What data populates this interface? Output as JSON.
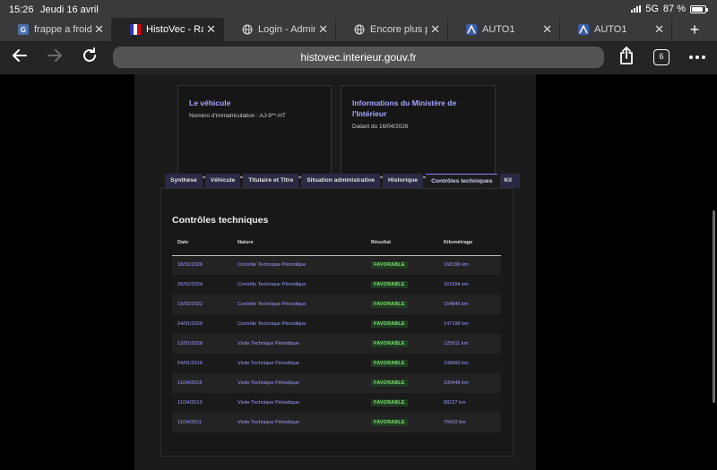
{
  "status": {
    "time": "15:26",
    "date": "Jeudi 16 avril",
    "network": "5G",
    "battery": "87 %"
  },
  "browser": {
    "tabs": [
      {
        "title": "frappe a froid c",
        "icon": "G",
        "color": "#4b6fa8"
      },
      {
        "title": "HistoVec - Rap",
        "icon": "HV",
        "color": "#24248a"
      },
      {
        "title": "Login - Admin",
        "icon": "globe",
        "color": "#3a3a3c"
      },
      {
        "title": "Encore plus pu",
        "icon": "globe",
        "color": "#3a3a3c"
      },
      {
        "title": "AUTO1",
        "icon": "A",
        "color": "#3b5ea8"
      },
      {
        "title": "AUTO1",
        "icon": "A",
        "color": "#3b5ea8"
      }
    ],
    "url": "histovec.interieur.gouv.fr",
    "tab_count": "6"
  },
  "cards": {
    "vehicle": {
      "title": "Le véhicule",
      "text": "Numéro d'immatriculation : AJ-9**-HT"
    },
    "ministry": {
      "title": "Informations du Ministère de l'Intérieur",
      "text": "Datant du 16/04/2026"
    }
  },
  "page_tabs": [
    "Synthèse",
    "Véhicule",
    "Titulaire et Titre",
    "Situation administrative",
    "Historique",
    "Contrôles techniques",
    "Kil"
  ],
  "section": {
    "title": "Contrôles techniques",
    "headers": {
      "date": "Date",
      "nature": "Nature",
      "result": "Résultat",
      "km": "Kilométrage"
    },
    "rows": [
      {
        "date": "18/02/2026",
        "nature": "Contrôle Technique Périodique",
        "result": "FAVORABLE",
        "km": "168196 km"
      },
      {
        "date": "20/02/2024",
        "nature": "Contrôle Technique Périodique",
        "result": "FAVORABLE",
        "km": "161594 km"
      },
      {
        "date": "19/02/2022",
        "nature": "Contrôle Technique Périodique",
        "result": "FAVORABLE",
        "km": "154845 km"
      },
      {
        "date": "24/01/2020",
        "nature": "Contrôle Technique Périodique",
        "result": "FAVORABLE",
        "km": "147198 km"
      },
      {
        "date": "12/01/2018",
        "nature": "Visite Technique Périodique",
        "result": "FAVORABLE",
        "km": "125911 km"
      },
      {
        "date": "04/01/2016",
        "nature": "Visite Technique Périodique",
        "result": "FAVORABLE",
        "km": "108683 km"
      },
      {
        "date": "11/04/2015",
        "nature": "Visite Technique Périodique",
        "result": "FAVORABLE",
        "km": "100446 km"
      },
      {
        "date": "11/04/2013",
        "nature": "Visite Technique Périodique",
        "result": "FAVORABLE",
        "km": "88127 km"
      },
      {
        "date": "11/04/2011",
        "nature": "Visite Technique Périodique",
        "result": "FAVORABLE",
        "km": "75602 km"
      }
    ]
  },
  "icons": {
    "back": "arrow-left-icon",
    "forward": "arrow-right-icon",
    "reload": "reload-icon",
    "share": "share-icon",
    "more": "more-icon"
  }
}
